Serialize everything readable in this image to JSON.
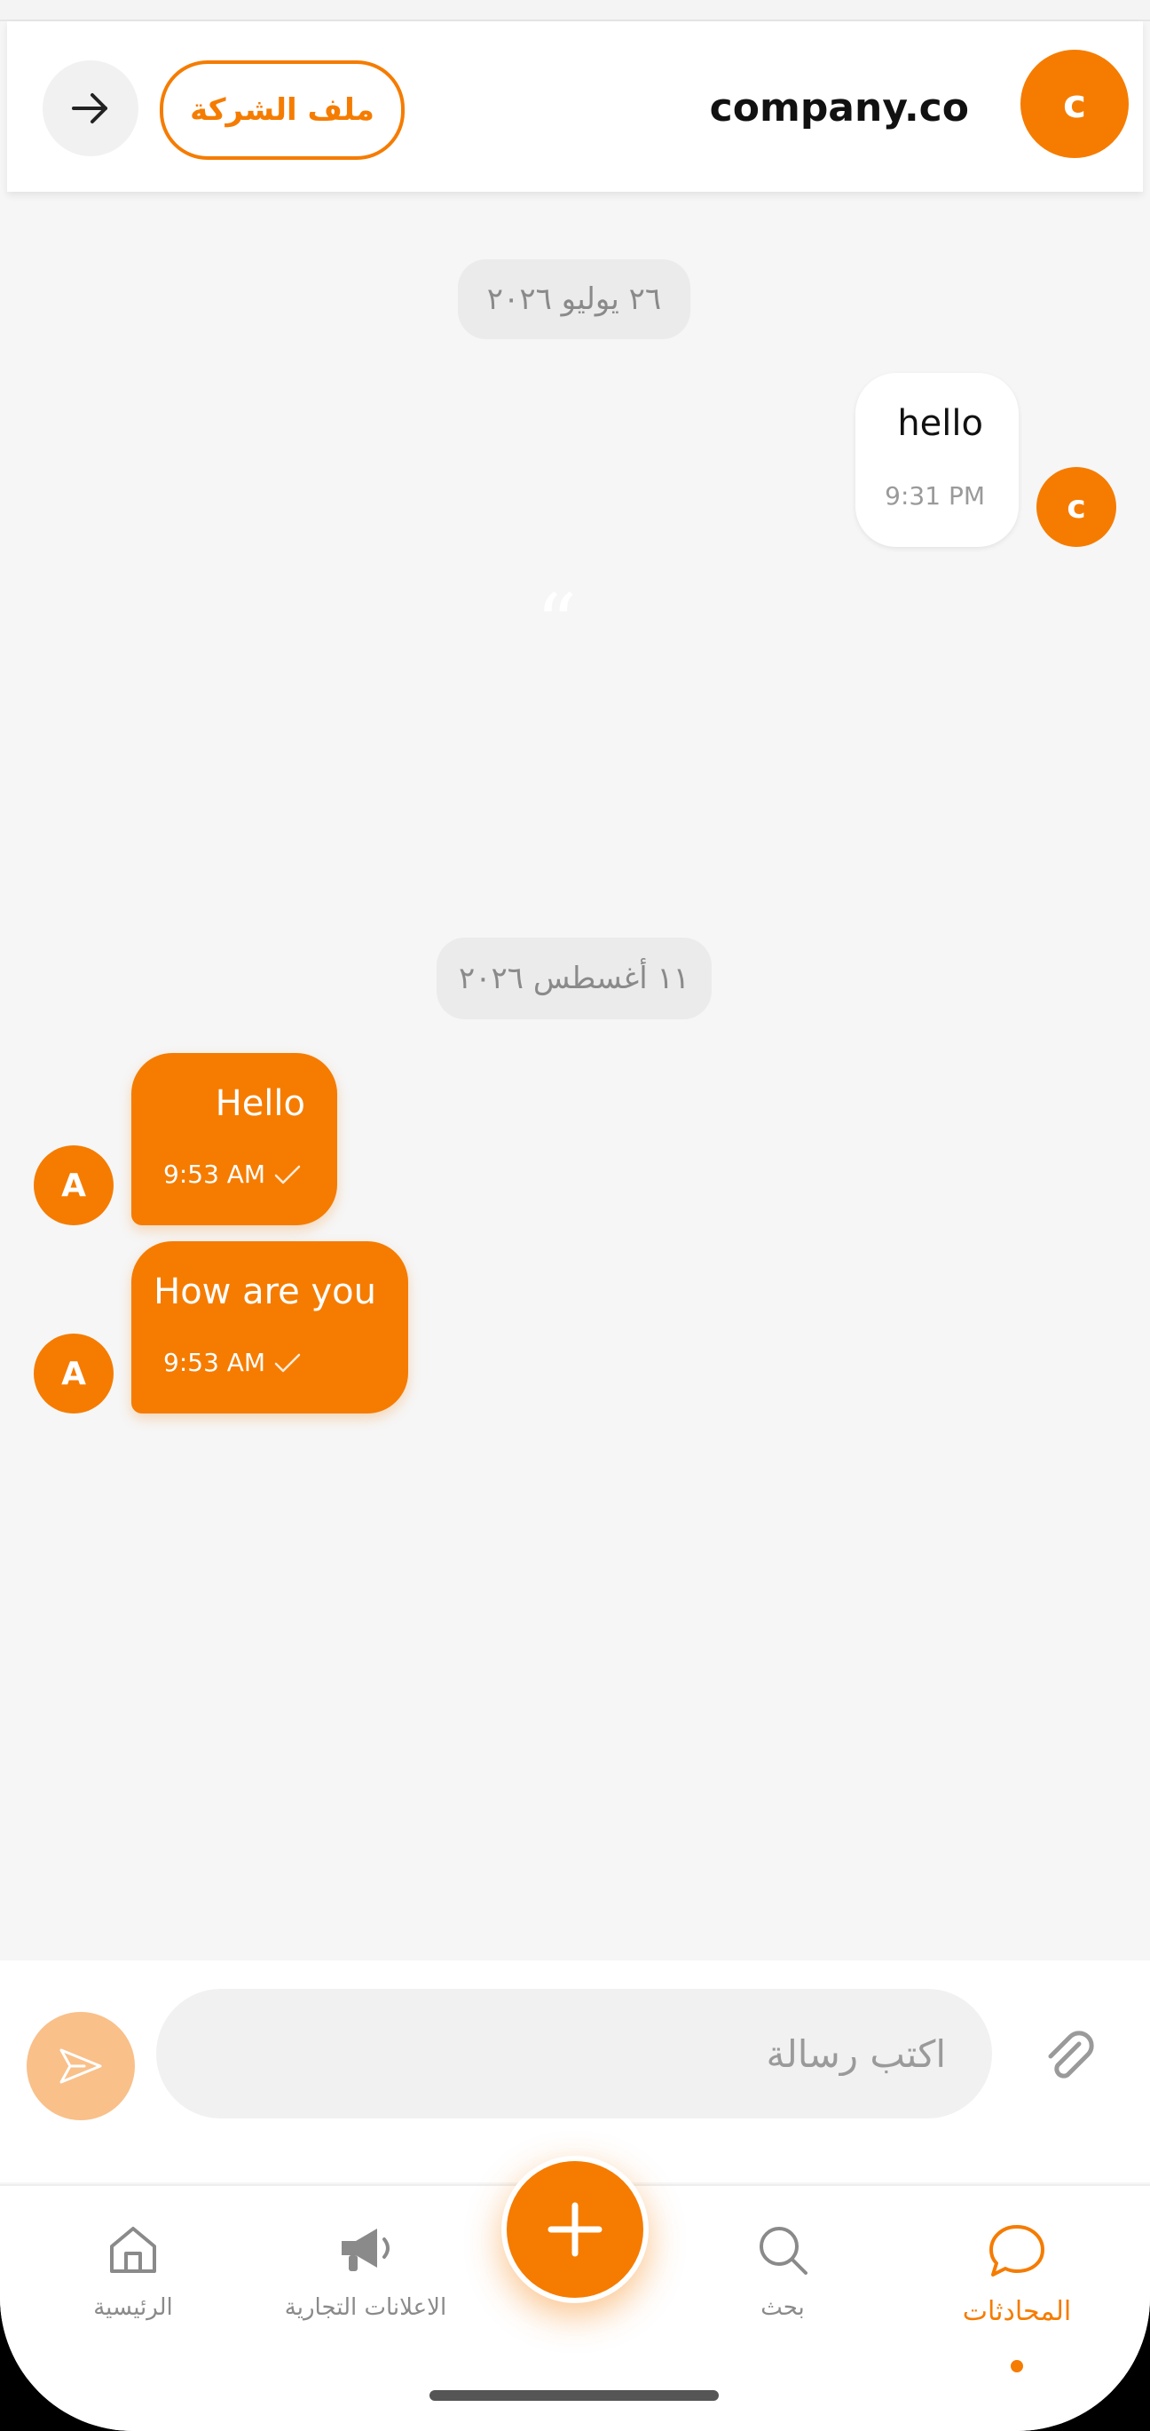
{
  "header": {
    "company_name": "company.co",
    "avatar_letter": "c",
    "profile_button_label": "ملف الشركة"
  },
  "messages": {
    "date1": "٢٦ يوليو ٢٠٢٦",
    "incoming": {
      "text": "hello",
      "time": "9:31 PM",
      "avatar_letter": "c"
    },
    "date2": "١١ أغسطس ٢٠٢٦",
    "outgoing": [
      {
        "text": "Hello",
        "time": "9:53 AM",
        "avatar_letter": "A"
      },
      {
        "text": "How are you",
        "time": "9:53 AM",
        "avatar_letter": "A"
      }
    ]
  },
  "composer": {
    "placeholder": "اكتب رسالة"
  },
  "tabbar": {
    "home": "الرئيسية",
    "ads": "الاعلانات التجارية",
    "search": "بحث",
    "chats": "المحادثات"
  },
  "colors": {
    "accent": "#f57c00",
    "accent_light": "#f9c08a",
    "background": "#f6f6f6"
  },
  "icons": {
    "back": "arrow-right-icon",
    "send": "send-icon",
    "attach": "paperclip-icon",
    "home": "home-icon",
    "ads": "megaphone-icon",
    "add": "plus-icon",
    "search": "search-icon",
    "chats": "chat-bubble-icon"
  }
}
